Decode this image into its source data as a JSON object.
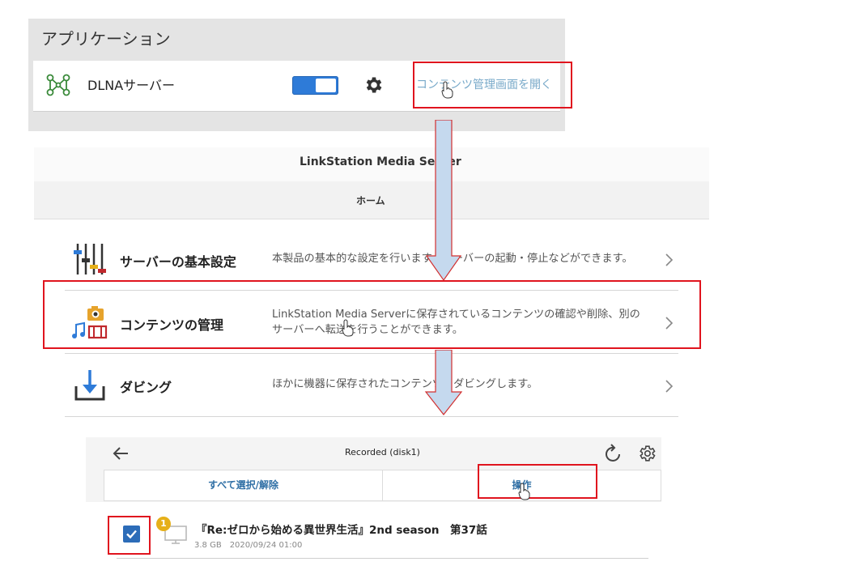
{
  "app_panel": {
    "title": "アプリケーション",
    "item": {
      "name": "DLNAサーバー",
      "icon": "dlna-network-icon",
      "toggle_on": true,
      "settings_icon": "gear-icon",
      "open_link": "コンテンツ管理画面を開く"
    }
  },
  "media_server": {
    "title": "LinkStation Media Server",
    "home_label": "ホーム",
    "menu": [
      {
        "title": "サーバーの基本設定",
        "icon": "sliders-icon",
        "desc": [
          "本製品の基本的な設定を行います。サーバーの起動・停止などができます。"
        ]
      },
      {
        "title": "コンテンツの管理",
        "icon": "media-content-icon",
        "desc": [
          "LinkStation Media Serverに保存されているコンテンツの確認や削除、別の",
          "サーバーへ転送を行うことができます。"
        ]
      },
      {
        "title": "ダビング",
        "icon": "download-tray-icon",
        "desc": [
          "ほかに機器に保存されたコンテンツをダビングします。"
        ]
      }
    ]
  },
  "recorded": {
    "title": "Recorded (disk1)",
    "select_all": "すべて選択/解除",
    "operation": "操作",
    "item": {
      "badge": "1",
      "title": "『Re:ゼロから始める異世界生活』2nd season　第37話",
      "meta": "3.8 GB　2020/09/24 01:00",
      "checked": true
    }
  },
  "colors": {
    "highlight": "#e0141e",
    "toggle": "#2e7bd8",
    "link": "#78a9c9",
    "accent": "#2c6cb8",
    "flow_arrow": "#c5d9ee",
    "badge": "#e6b019"
  }
}
